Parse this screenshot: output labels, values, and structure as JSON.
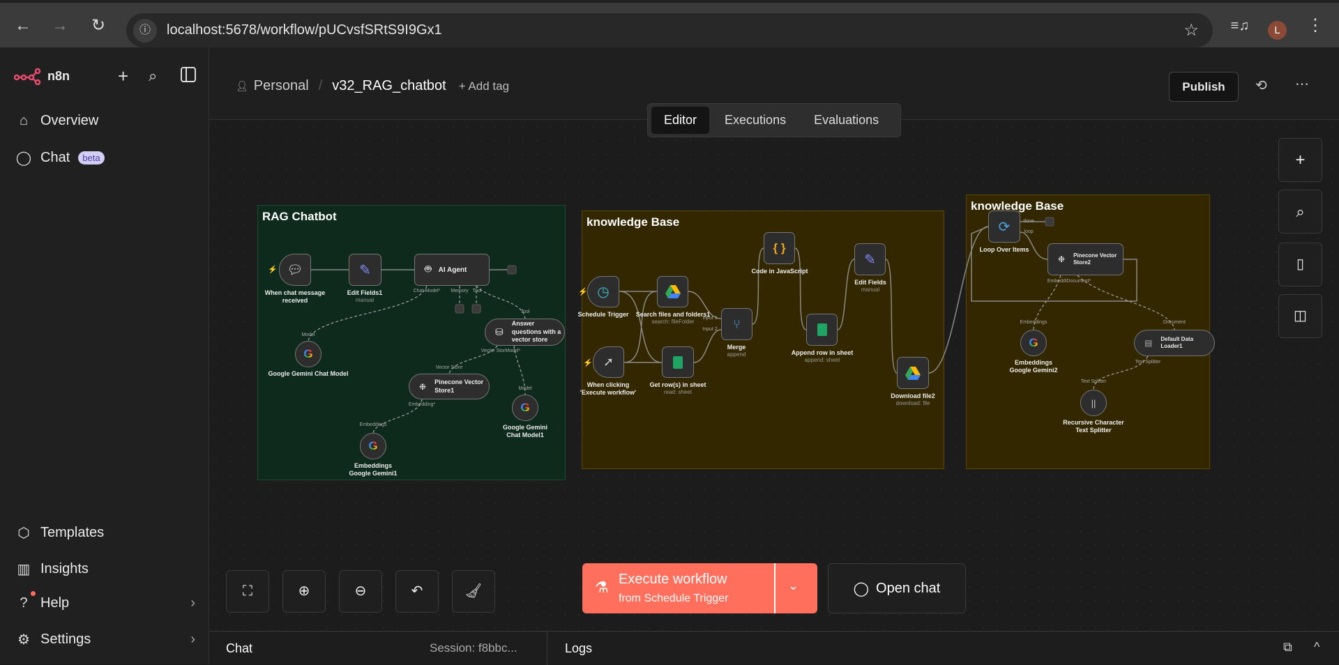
{
  "browser": {
    "url": "localhost:5678/workflow/pUCvsfSRtS9I9Gx1",
    "avatar": "L"
  },
  "sidebar": {
    "brand": "n8n",
    "items": [
      {
        "label": "Overview"
      },
      {
        "label": "Chat",
        "badge": "beta"
      },
      {
        "label": "Templates"
      },
      {
        "label": "Insights"
      },
      {
        "label": "Help"
      },
      {
        "label": "Settings"
      }
    ]
  },
  "header": {
    "project": "Personal",
    "workflow_name": "v32_RAG_chatbot",
    "add_tag": "+ Add tag",
    "publish": "Publish"
  },
  "tabs": [
    "Editor",
    "Executions",
    "Evaluations"
  ],
  "groups": {
    "rag": "RAG Chatbot",
    "kb1": "knowledge Base",
    "kb2": "knowledge Base"
  },
  "nodes": {
    "chat_trigger": {
      "label": "When chat message received"
    },
    "edit_fields1": {
      "label": "Edit Fields1",
      "sub": "manual"
    },
    "ai_agent": {
      "label": "AI Agent"
    },
    "gemini_chat": {
      "label": "Google Gemini Chat Model"
    },
    "answer_vs": {
      "label": "Answer questions with a vector store"
    },
    "pinecone1": {
      "label": "Pinecone Vector Store1"
    },
    "gemini_chat1": {
      "label": "Google Gemini Chat Model1"
    },
    "emb_gemini1": {
      "label": "Embeddings Google Gemini1"
    },
    "schedule": {
      "label": "Schedule Trigger"
    },
    "search_files": {
      "label": "Search files and folders1",
      "sub": "search: fileFolder"
    },
    "manual_trigger": {
      "label": "When clicking 'Execute workflow'"
    },
    "get_rows": {
      "label": "Get row(s) in sheet",
      "sub": "read: sheet"
    },
    "merge": {
      "label": "Merge",
      "sub": "append"
    },
    "code_js": {
      "label": "Code in JavaScript"
    },
    "append_row": {
      "label": "Append row in sheet",
      "sub": "append: sheet"
    },
    "edit_fields": {
      "label": "Edit Fields",
      "sub": "manual"
    },
    "download": {
      "label": "Download file2",
      "sub": "download: file"
    },
    "loop": {
      "label": "Loop Over Items"
    },
    "pinecone2": {
      "label": "Pinecone Vector Store2"
    },
    "emb_gemini2": {
      "label": "Embeddings Google Gemini2"
    },
    "loader": {
      "label": "Default Data Loader1"
    },
    "splitter": {
      "label": "Recursive Character Text Splitter"
    }
  },
  "handles": {
    "chat_model": "Chat Model*",
    "memory": "Memory",
    "tool": "Tool",
    "model": "Model",
    "vector_store": "Vector Store",
    "embedding": "Embedding*",
    "embeddings": "Embeddings",
    "input1": "Input 1",
    "input2": "Input 2",
    "done": "done",
    "loop": "loop",
    "document": "Document",
    "text_splitter": "Text Splitter",
    "vs_model": "Vector StorModel*",
    "emb_doc": "EmbeddiDocument*"
  },
  "toolbar": {
    "execute": "Execute workflow",
    "execute_sub": "from Schedule Trigger",
    "open_chat": "Open chat"
  },
  "bottom": {
    "chat": "Chat",
    "session": "Session: f8bbc...",
    "logs": "Logs"
  },
  "colors": {
    "accent": "#ff6f5c",
    "rag_group": "#0d2a1c",
    "kb_group": "#332700"
  }
}
